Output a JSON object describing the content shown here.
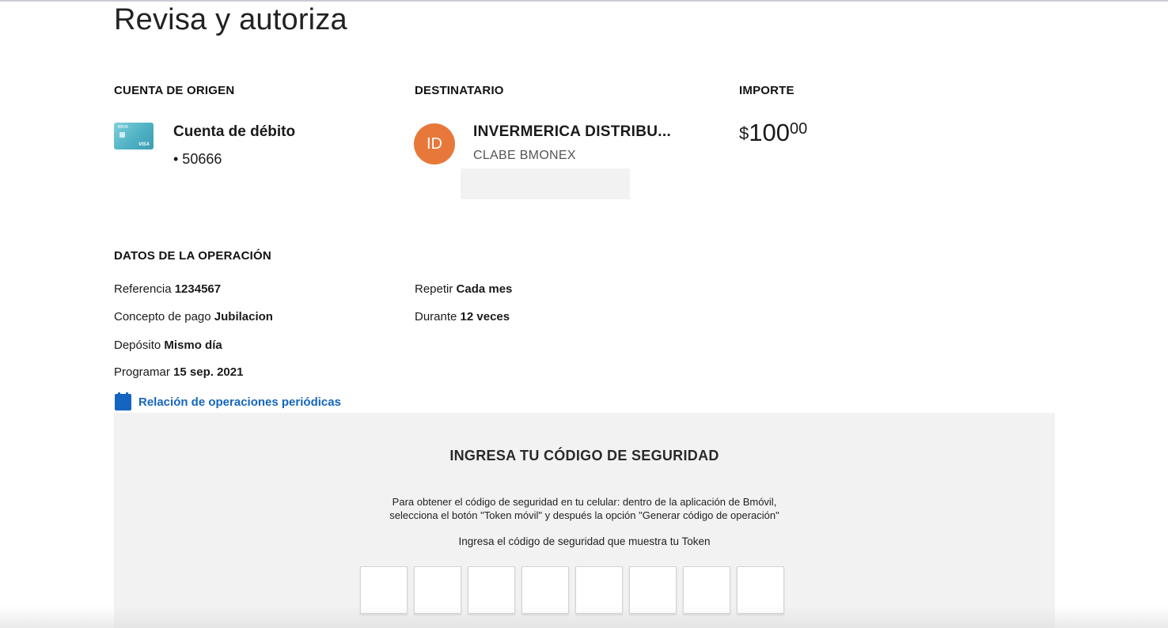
{
  "page": {
    "title": "Revisa y autoriza"
  },
  "origin": {
    "header": "CUENTA DE ORIGEN",
    "card_icon": "debit-card-icon",
    "account_name": "Cuenta de débito",
    "account_number": "• 50666"
  },
  "recipient": {
    "header": "DESTINATARIO",
    "initials": "ID",
    "name": "INVERMERICA DISTRIBU...",
    "account_type": "CLABE BMONEX",
    "avatar_color": "#e8783a"
  },
  "amount": {
    "header": "IMPORTE",
    "currency": "$",
    "integer": "100",
    "decimals": "00"
  },
  "operation": {
    "header": "DATOS DE LA OPERACIÓN",
    "left": [
      {
        "label": "Referencia",
        "value": "1234567"
      },
      {
        "label": "Concepto de pago",
        "value": "Jubilacion"
      },
      {
        "label": "Depósito",
        "value": "Mismo día"
      },
      {
        "label": "Programar",
        "value": "15 sep. 2021"
      }
    ],
    "right": [
      {
        "label": "Repetir",
        "value": "Cada mes"
      },
      {
        "label": "Durante",
        "value": "12 veces"
      }
    ]
  },
  "periodic_link": {
    "label": "Relación de operaciones periódicas",
    "icon": "calendar-icon",
    "color": "#1565c0"
  },
  "security": {
    "title": "INGRESA TU CÓDIGO DE SEGURIDAD",
    "instruction_line1": "Para obtener el código de seguridad en tu celular: dentro de la aplicación de Bmóvil,",
    "instruction_line2": "selecciona el botón \"Token móvil\" y después la opción \"Generar código de operación\"",
    "prompt": "Ingresa el código de seguridad que muestra tu Token",
    "code_length": 8
  }
}
